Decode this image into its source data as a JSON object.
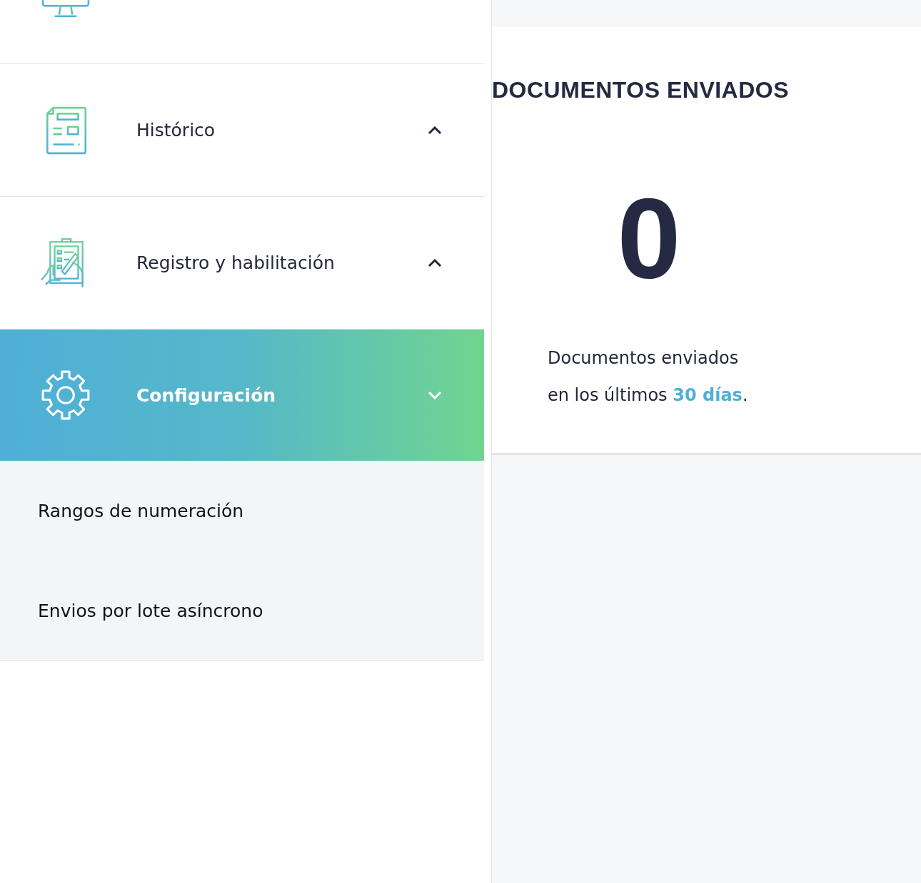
{
  "sidebar": {
    "items": [
      {
        "kind": "link",
        "selected": false
      },
      {
        "label": "Histórico",
        "kind": "group",
        "expanded": false,
        "selected": false
      },
      {
        "label": "Registro y habilitación",
        "kind": "group",
        "expanded": false,
        "selected": false
      },
      {
        "label": "Configuración",
        "kind": "group",
        "expanded": true,
        "selected": true,
        "children": [
          {
            "label": "Rangos de numeración"
          },
          {
            "label": "Envios por lote asíncrono"
          }
        ]
      }
    ]
  },
  "card": {
    "title": "DOCUMENTOS ENVIADOS",
    "value": "0",
    "description": "Documentos enviados en los últimos **30 días**."
  }
}
